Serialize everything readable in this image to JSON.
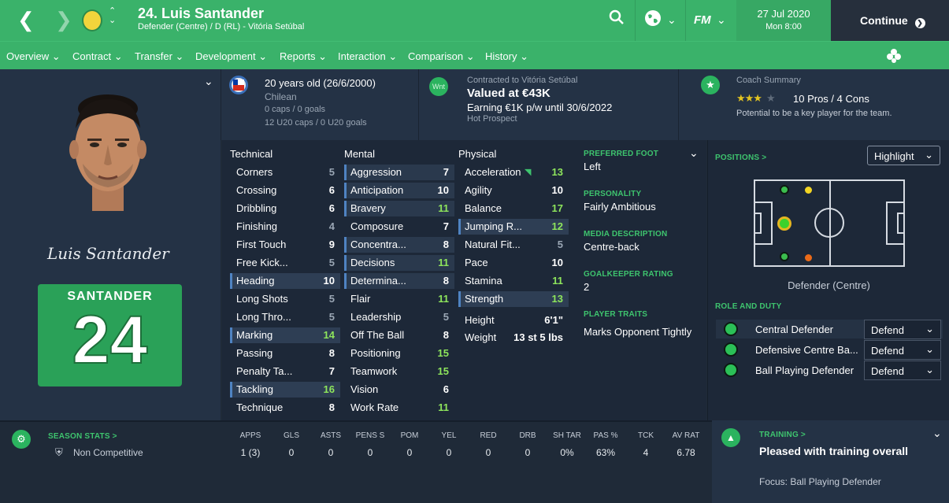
{
  "header": {
    "player_title": "24. Luis Santander",
    "subtitle": "Defender (Centre) / D (RL) - Vitória Setúbal",
    "date": "27 Jul 2020",
    "time": "Mon 8:00",
    "continue_label": "Continue",
    "fm_label": "FM"
  },
  "nav": [
    "Overview",
    "Contract",
    "Transfer",
    "Development",
    "Reports",
    "Interaction",
    "Comparison",
    "History"
  ],
  "profile": {
    "age": "20 years old (26/6/2000)",
    "nationality": "Chilean",
    "caps": "0 caps / 0 goals",
    "u20": "12 U20 caps / 0 U20 goals",
    "contract_label": "Contracted to Vitória Setúbal",
    "value": "Valued at €43K",
    "earning": "Earning €1K p/w until 30/6/2022",
    "prospect": "Hot Prospect",
    "wnt": "Wnt",
    "coach_title": "Coach Summary",
    "pros_cons": "10 Pros / 4 Cons",
    "coach_note": "Potential to be a key player for the team.",
    "stars": 3.5,
    "signature": "Luis Santander",
    "shirt_name": "SANTANDER",
    "shirt_number": "24"
  },
  "attributes": {
    "technical_title": "Technical",
    "mental_title": "Mental",
    "physical_title": "Physical",
    "technical": [
      {
        "n": "Corners",
        "v": "5"
      },
      {
        "n": "Crossing",
        "v": "6"
      },
      {
        "n": "Dribbling",
        "v": "6"
      },
      {
        "n": "Finishing",
        "v": "4"
      },
      {
        "n": "First Touch",
        "v": "9"
      },
      {
        "n": "Free Kick...",
        "v": "5"
      },
      {
        "n": "Heading",
        "v": "10"
      },
      {
        "n": "Long Shots",
        "v": "5"
      },
      {
        "n": "Long Thro...",
        "v": "5"
      },
      {
        "n": "Marking",
        "v": "14"
      },
      {
        "n": "Passing",
        "v": "8"
      },
      {
        "n": "Penalty Ta...",
        "v": "7"
      },
      {
        "n": "Tackling",
        "v": "16"
      },
      {
        "n": "Technique",
        "v": "8"
      }
    ],
    "mental": [
      {
        "n": "Aggression",
        "v": "7"
      },
      {
        "n": "Anticipation",
        "v": "10"
      },
      {
        "n": "Bravery",
        "v": "11"
      },
      {
        "n": "Composure",
        "v": "7"
      },
      {
        "n": "Concentra...",
        "v": "8"
      },
      {
        "n": "Decisions",
        "v": "11"
      },
      {
        "n": "Determina...",
        "v": "8"
      },
      {
        "n": "Flair",
        "v": "11"
      },
      {
        "n": "Leadership",
        "v": "5"
      },
      {
        "n": "Off The Ball",
        "v": "8"
      },
      {
        "n": "Positioning",
        "v": "15"
      },
      {
        "n": "Teamwork",
        "v": "15"
      },
      {
        "n": "Vision",
        "v": "6"
      },
      {
        "n": "Work Rate",
        "v": "11"
      }
    ],
    "physical": [
      {
        "n": "Acceleration",
        "v": "13"
      },
      {
        "n": "Agility",
        "v": "10"
      },
      {
        "n": "Balance",
        "v": "17"
      },
      {
        "n": "Jumping R...",
        "v": "12"
      },
      {
        "n": "Natural Fit...",
        "v": "5"
      },
      {
        "n": "Pace",
        "v": "10"
      },
      {
        "n": "Stamina",
        "v": "11"
      },
      {
        "n": "Strength",
        "v": "13"
      }
    ],
    "height_label": "Height",
    "height": "6'1\"",
    "weight_label": "Weight",
    "weight": "13 st 5 lbs"
  },
  "details": {
    "foot_label": "PREFERRED FOOT",
    "foot": "Left",
    "personality_label": "PERSONALITY",
    "personality": "Fairly Ambitious",
    "media_label": "MEDIA DESCRIPTION",
    "media": "Centre-back",
    "gk_label": "GOALKEEPER RATING",
    "gk": "2",
    "traits_label": "PLAYER TRAITS",
    "traits": "Marks Opponent Tightly"
  },
  "positions": {
    "title": "POSITIONS >",
    "highlight": "Highlight",
    "position_name": "Defender (Centre)",
    "role_title": "ROLE AND DUTY",
    "roles": [
      {
        "name": "Central Defender",
        "duty": "Defend"
      },
      {
        "name": "Defensive Centre Ba...",
        "duty": "Defend"
      },
      {
        "name": "Ball Playing Defender",
        "duty": "Defend"
      }
    ]
  },
  "season": {
    "title": "SEASON STATS >",
    "competition": "Non Competitive",
    "headers": [
      "APPS",
      "GLS",
      "ASTS",
      "PENS S",
      "POM",
      "YEL",
      "RED",
      "DRB",
      "SH TAR",
      "PAS %",
      "TCK",
      "AV RAT"
    ],
    "values": [
      "1 (3)",
      "0",
      "0",
      "0",
      "0",
      "0",
      "0",
      "0",
      "0%",
      "63%",
      "4",
      "6.78"
    ]
  },
  "training": {
    "title": "TRAINING >",
    "status": "Pleased with training overall",
    "focus_label": "Focus:",
    "focus": "Ball Playing Defender"
  },
  "colors": {
    "green": "#3ab26a",
    "bright_green": "#8ee55c",
    "highlight_blue": "#4f83c2"
  }
}
